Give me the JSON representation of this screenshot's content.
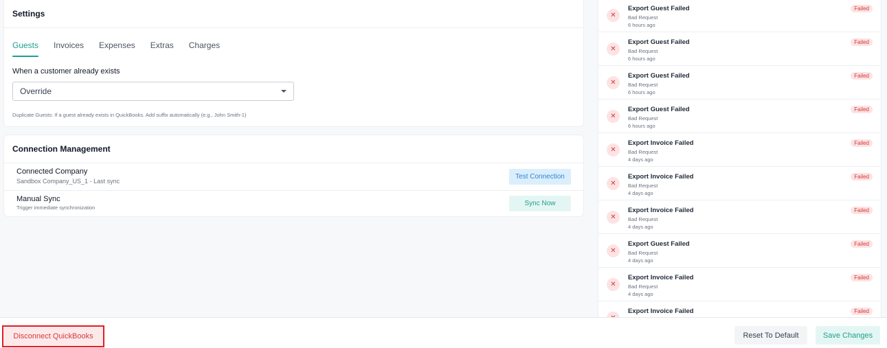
{
  "settings": {
    "title": "Settings",
    "tabs": [
      {
        "label": "Guests",
        "active": true
      },
      {
        "label": "Invoices",
        "active": false
      },
      {
        "label": "Expenses",
        "active": false
      },
      {
        "label": "Extras",
        "active": false
      },
      {
        "label": "Charges",
        "active": false
      }
    ],
    "field_label": "When a customer already exists",
    "select_value": "Override",
    "helper": "Duplicate Guests: If a guest already exists in QuickBooks. Add suffix automatically (e.g., John Smith-1)"
  },
  "connection": {
    "title": "Connection Management",
    "company_title": "Connected Company",
    "company_sub": "Sandbox Company_US_1 - Last sync",
    "test_label": "Test Connection",
    "sync_title": "Manual Sync",
    "sync_sub": "Trigger immediate synchronization",
    "sync_label": "Sync Now"
  },
  "activity": [
    {
      "title": "Export Guest Failed",
      "sub": "Bad Request",
      "time": "6 hours ago",
      "status": "Failed"
    },
    {
      "title": "Export Guest Failed",
      "sub": "Bad Request",
      "time": "6 hours ago",
      "status": "Failed"
    },
    {
      "title": "Export Guest Failed",
      "sub": "Bad Request",
      "time": "6 hours ago",
      "status": "Failed"
    },
    {
      "title": "Export Guest Failed",
      "sub": "Bad Request",
      "time": "6 hours ago",
      "status": "Failed"
    },
    {
      "title": "Export Invoice Failed",
      "sub": "Bad Request",
      "time": "4 days ago",
      "status": "Failed"
    },
    {
      "title": "Export Invoice Failed",
      "sub": "Bad Request",
      "time": "4 days ago",
      "status": "Failed"
    },
    {
      "title": "Export Invoice Failed",
      "sub": "Bad Request",
      "time": "4 days ago",
      "status": "Failed"
    },
    {
      "title": "Export Guest Failed",
      "sub": "Bad Request",
      "time": "4 days ago",
      "status": "Failed"
    },
    {
      "title": "Export Invoice Failed",
      "sub": "Bad Request",
      "time": "4 days ago",
      "status": "Failed"
    },
    {
      "title": "Export Invoice Failed",
      "sub": "",
      "time": "",
      "status": "Failed"
    }
  ],
  "footer": {
    "disconnect_label": "Disconnect QuickBooks",
    "reset_label": "Reset To Default",
    "save_label": "Save Changes"
  },
  "icons": {
    "dismiss": "✕",
    "dropdown": "caret-down-icon"
  }
}
